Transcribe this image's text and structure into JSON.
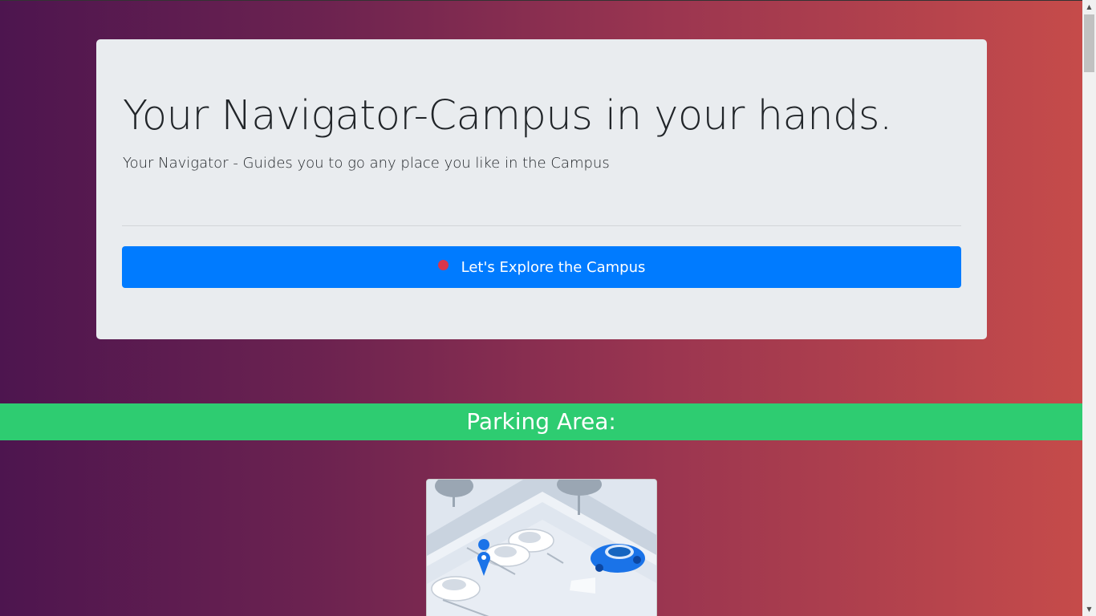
{
  "hero": {
    "headline": "Your Navigator-Campus in your hands.",
    "lead": "Your Navigator - Guides you to go any place you like in the Campus",
    "button_label": "Let's Explore the Campus"
  },
  "sections": {
    "parking_title": "Parking Area:"
  },
  "colors": {
    "gradient_start": "#4d154f",
    "gradient_end": "#c74c4a",
    "jumbotron_bg": "#e9ecef",
    "primary_button": "#007bff",
    "section_band": "#2ecc71",
    "pin_dot": "#d9364b"
  },
  "icons": {
    "button_icon": "map-pin-dot-icon",
    "scroll_up": "triangle-up",
    "scroll_down": "triangle-down"
  }
}
